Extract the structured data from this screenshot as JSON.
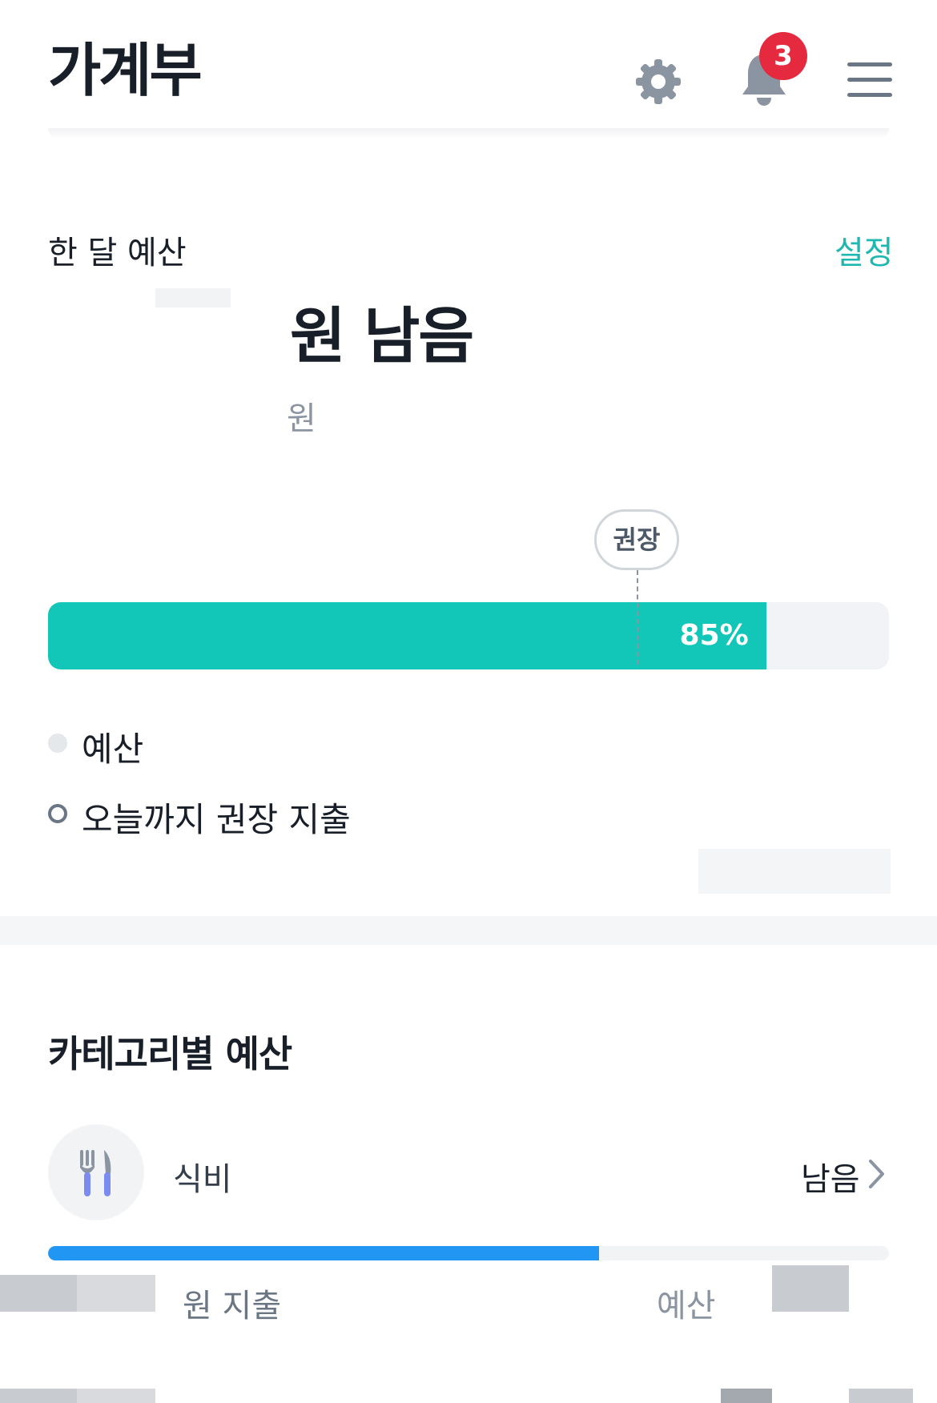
{
  "header": {
    "title": "가계부",
    "notification_count": "3",
    "icons": {
      "settings": "gear-icon",
      "notifications": "bell-icon",
      "menu": "hamburger-menu-icon"
    }
  },
  "budget": {
    "label": "한 달 예산",
    "settings_link": "설정",
    "remaining_text": "원 남음",
    "subamount_text": "원",
    "recommended_label": "권장",
    "progress_percent_text": "85%",
    "progress_fraction": 0.854,
    "recommended_fraction": 0.7,
    "legend": [
      {
        "label": "예산"
      },
      {
        "label": "오늘까지 권장 지출"
      }
    ],
    "colors": {
      "progress": "#12c7b8",
      "link": "#1fb8b0"
    }
  },
  "categories": {
    "title": "카테고리별 예산",
    "items": [
      {
        "name": "식비",
        "icon": "fork-knife-icon",
        "remaining_text": "남음",
        "spent_text": "원 지출",
        "budget_text": "예산",
        "progress_fraction": 0.655,
        "color": "#2196f3"
      }
    ]
  }
}
